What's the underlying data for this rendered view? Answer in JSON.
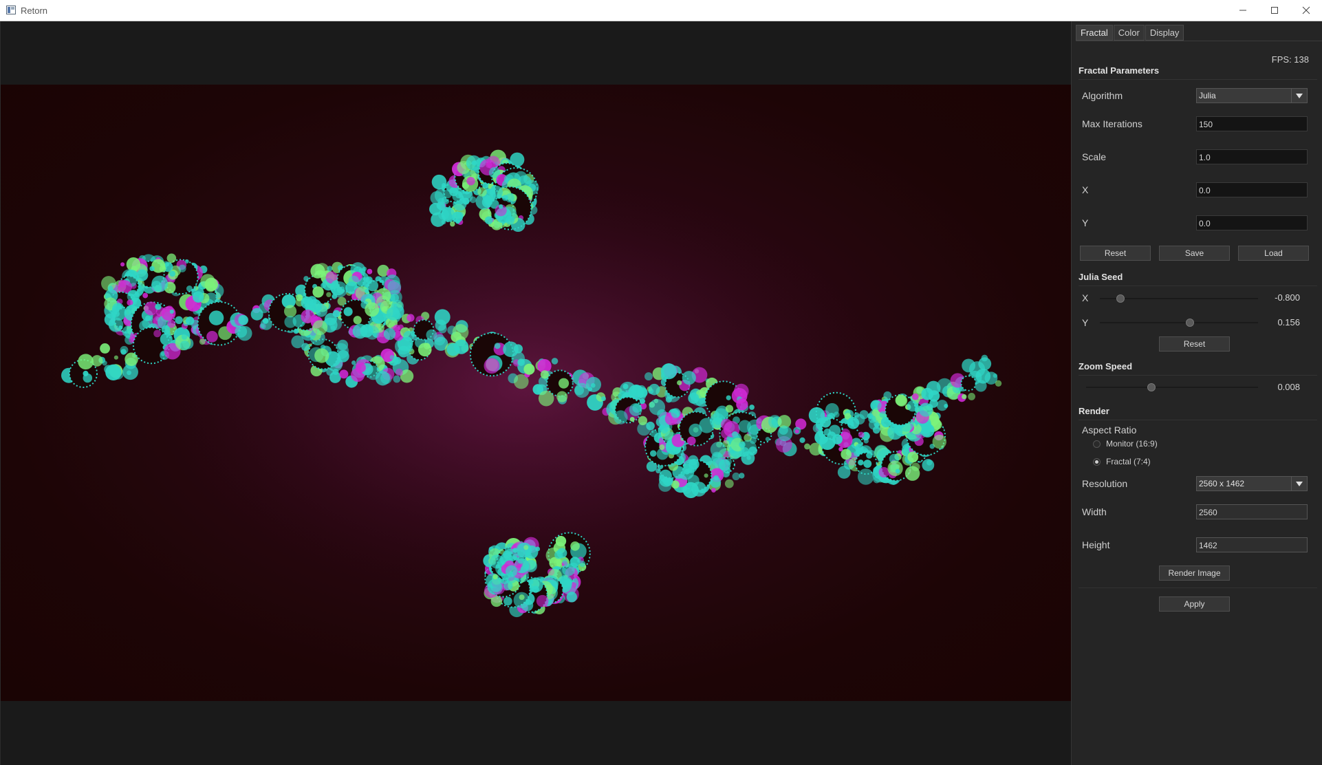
{
  "window": {
    "title": "Retorn"
  },
  "tabs": [
    "Fractal",
    "Color",
    "Display"
  ],
  "fps": "FPS: 138",
  "fractal_params": {
    "heading": "Fractal Parameters",
    "algorithm_label": "Algorithm",
    "algorithm_value": "Julia",
    "max_iterations_label": "Max Iterations",
    "max_iterations_value": "150",
    "scale_label": "Scale",
    "scale_value": "1.0",
    "x_label": "X",
    "x_value": "0.0",
    "y_label": "Y",
    "y_value": "0.0",
    "reset_label": "Reset",
    "save_label": "Save",
    "load_label": "Load"
  },
  "julia_seed": {
    "heading": "Julia Seed",
    "x_label": "X",
    "x_value": "-0.800",
    "y_label": "Y",
    "y_value": "0.156",
    "reset_label": "Reset",
    "x_level": 0.13,
    "y_level": 0.57
  },
  "zoom_speed": {
    "heading": "Zoom Speed",
    "value": "0.008",
    "level": 0.38
  },
  "render": {
    "heading": "Render",
    "aspect_label": "Aspect Ratio",
    "aspect_options": [
      "Monitor (16:9)",
      "Fractal (7:4)"
    ],
    "aspect_selected": "Fractal (7:4)",
    "resolution_label": "Resolution",
    "resolution_value": "2560 x 1462",
    "width_label": "Width",
    "width_value": "2560",
    "height_label": "Height",
    "height_value": "1462",
    "render_image_label": "Render Image",
    "apply_label": "Apply"
  },
  "colors": {
    "fractal_background": "#2a0712",
    "fractal_cyan": "#2fd6c6",
    "fractal_green": "#7cf27a",
    "fractal_magenta": "#d02ad6"
  }
}
